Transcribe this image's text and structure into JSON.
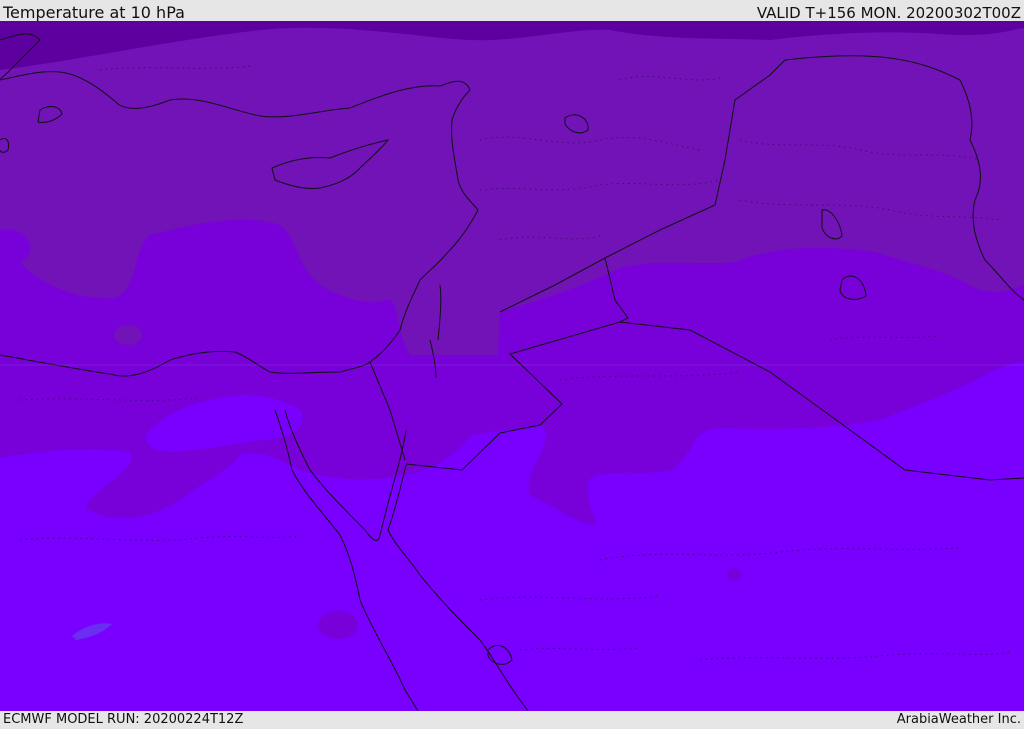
{
  "header": {
    "title": "Temperature at 10 hPa",
    "valid_time": "VALID T+156 MON. 20200302T00Z"
  },
  "footer": {
    "model_run": "ECMWF MODEL RUN: 20200224T12Z",
    "credit": "ArabiaWeather Inc."
  },
  "colors": {
    "band_coldest": "#5e00a0",
    "band_cold": "#7113b7",
    "band_mid": "#7800d8",
    "band_warm": "#7900ff",
    "coastline": "#111111",
    "border": "#111111",
    "frame_background": "#e6e6e6"
  }
}
